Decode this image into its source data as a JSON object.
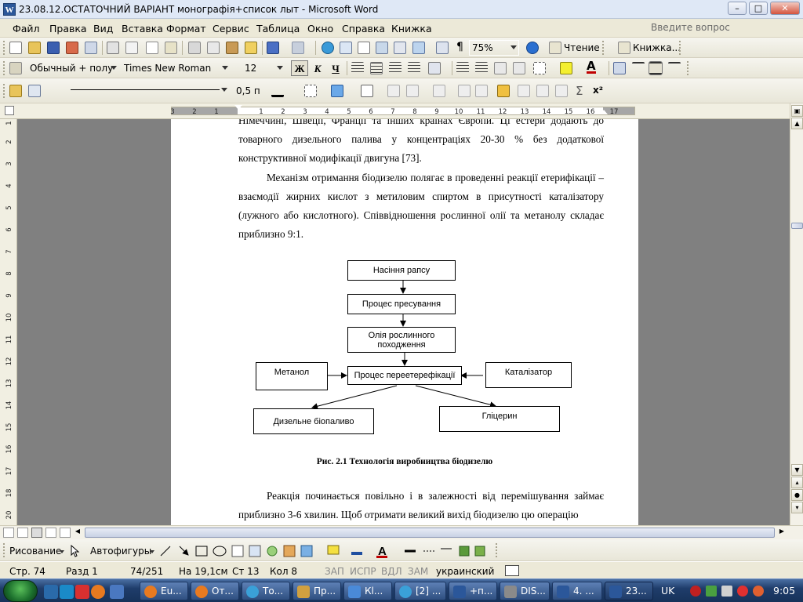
{
  "window": {
    "title": "23.08.12.ОСТАТОЧНИЙ ВАРІАНТ монографія+список лыт - Microsoft Word",
    "app_icon": "W",
    "min": "–",
    "max": "□",
    "close": "✕"
  },
  "menu": {
    "items": [
      "Файл",
      "Правка",
      "Вид",
      "Вставка",
      "Формат",
      "Сервис",
      "Таблица",
      "Окно",
      "Справка",
      "Книжка"
    ],
    "help_placeholder": "Введите вопрос"
  },
  "standard_toolbar": {
    "zoom": "75%",
    "read_label": "Чтение",
    "book_label": "Книжка...",
    "pilcrow": "¶"
  },
  "formatting_toolbar": {
    "style": "Обычный + полу",
    "font": "Times New Roman",
    "size": "12",
    "bold": "Ж",
    "italic": "К",
    "underline": "Ч",
    "font_color_letter": "A"
  },
  "drawing_toolbar_top": {
    "line_weight": "0,5 п",
    "sigma": "Σ",
    "superscript": "x²"
  },
  "ruler": {
    "numbers": [
      "3",
      "2",
      "1",
      "1",
      "2",
      "3",
      "4",
      "5",
      "6",
      "7",
      "8",
      "9",
      "10",
      "11",
      "12",
      "13",
      "14",
      "15",
      "16",
      "17"
    ],
    "vnumbers": [
      "1",
      "2",
      "3",
      "4",
      "5",
      "6",
      "7",
      "8",
      "9",
      "10",
      "11",
      "12",
      "13",
      "14",
      "15",
      "16",
      "17",
      "18",
      "19",
      "20"
    ]
  },
  "document": {
    "para1": "Німеччині, Швеції, Франції та інших країнах Європи. Ці естери додають до товарного дизельного палива у концентраціях 20-30 % без додаткової конструктивної модифікації двигуна [73].",
    "para2": "Механізм отримання біодизелю полягає в проведенні реакції етерифікації – взаємодії жирних кислот з метиловим спиртом в присутності каталізатору (лужного або кислотного). Співвідношення рослинної олії та метанолу складає приблизно 9:1.",
    "flowchart": {
      "step1": "Насіння рапсу",
      "step2": "Процес пресування",
      "step3": "Олія рослинного походження",
      "step4": "Процес переетерефікації",
      "input_left": "Метанол",
      "input_right": "Каталізатор",
      "output_left": "Дизельне біопаливо",
      "output_right": "Гліцерин"
    },
    "caption": "Рис. 2.1   Технологія виробництва біодизелю",
    "para3": "Реакція починається повільно і в залежності від перемішування займає приблизно 3-6 хвилин. Щоб отримати великий вихід біодизелю цю операцію"
  },
  "drawing_toolbar": {
    "draw_label": "Рисование",
    "autoshapes_label": "Автофигуры"
  },
  "status": {
    "page": "Стр. 74",
    "section": "Разд 1",
    "pages": "74/251",
    "at": "На 19,1см",
    "line": "Ст 13",
    "col": "Кол 8",
    "rec": "ЗАП",
    "trk": "ИСПР",
    "ext": "ВДЛ",
    "ovr": "ЗАМ",
    "lang": "украинский"
  },
  "taskbar": {
    "tasks": [
      "Eu...",
      "От...",
      "То...",
      "Пр...",
      "Кl...",
      "[2] ...",
      "+п...",
      "DIS...",
      "4. ...",
      "23..."
    ],
    "lang": "UK",
    "clock": "9:05"
  },
  "colors": {
    "accent": "#2b579a",
    "page": "#ffffff",
    "workspace": "#808080",
    "taskbar": "#1f3d6b"
  }
}
